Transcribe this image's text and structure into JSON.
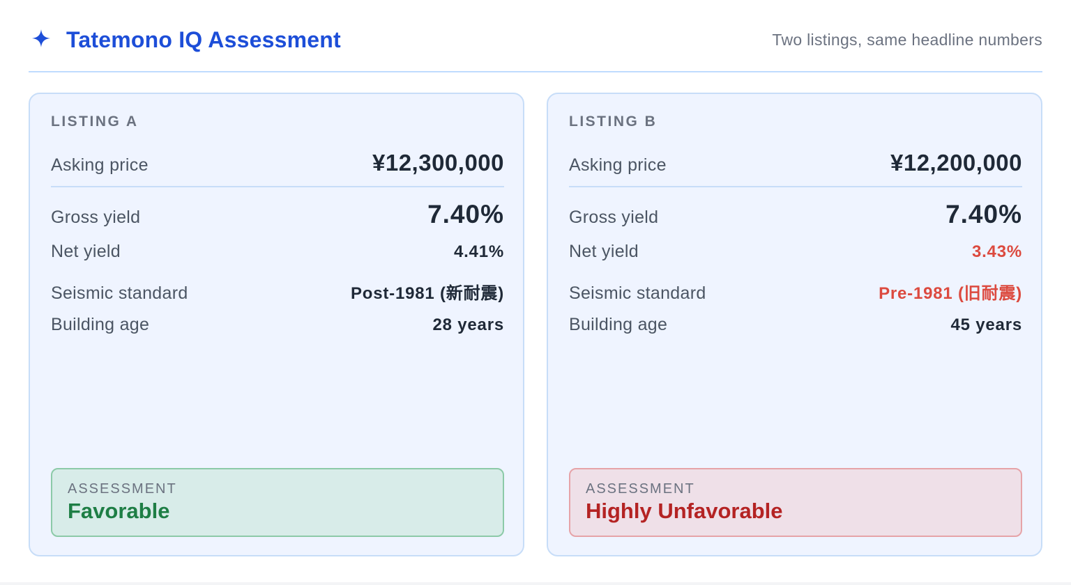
{
  "header": {
    "title": "Tatemono IQ Assessment",
    "subtitle": "Two listings, same headline numbers",
    "icon": "sparkle-icon"
  },
  "labels": {
    "asking_price": "Asking price",
    "gross_yield": "Gross yield",
    "net_yield": "Net yield",
    "seismic": "Seismic standard",
    "building_age": "Building age",
    "assessment": "ASSESSMENT"
  },
  "listings": [
    {
      "label": "LISTING A",
      "asking_price": "¥12,300,000",
      "gross_yield": "7.40%",
      "net_yield": "4.41%",
      "seismic": "Post-1981 (新耐震)",
      "building_age": "28 years",
      "assessment": "Favorable"
    },
    {
      "label": "LISTING B",
      "asking_price": "¥12,200,000",
      "gross_yield": "7.40%",
      "net_yield": "3.43%",
      "seismic": "Pre-1981 (旧耐震)",
      "building_age": "45 years",
      "assessment": "Highly Unfavorable"
    }
  ],
  "colors": {
    "brand": "#1d4ed8",
    "warning": "#dc4a3f",
    "favorable": "#1e7e45",
    "unfavorable": "#b42323"
  }
}
